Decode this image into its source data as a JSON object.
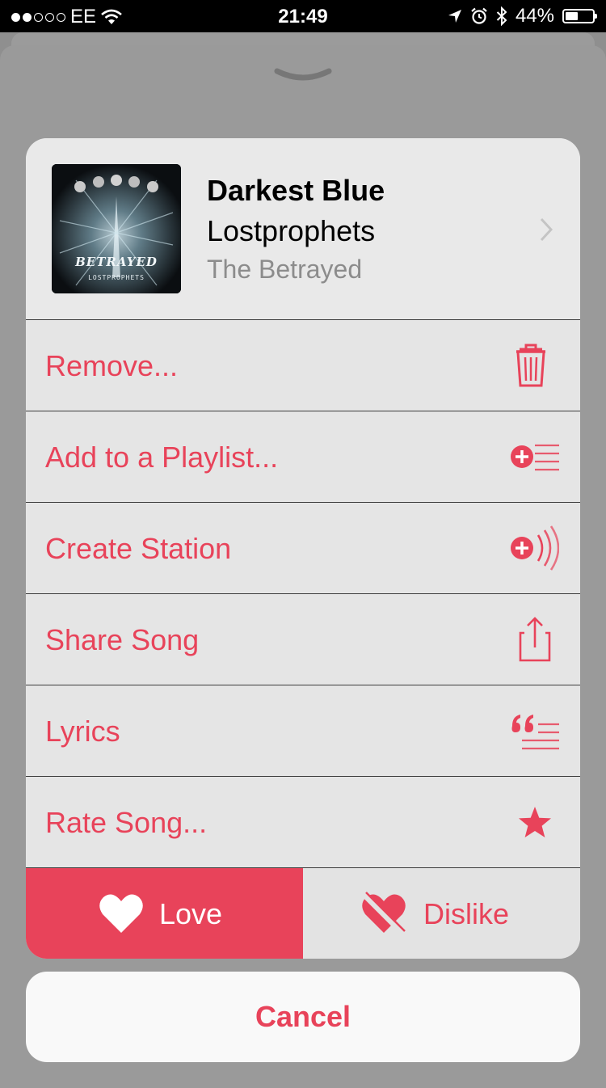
{
  "status_bar": {
    "carrier": "EE",
    "time": "21:49",
    "battery_percent": "44%",
    "battery_level": 0.44,
    "signal_bars_filled": 2,
    "signal_bars_total": 5
  },
  "song": {
    "title": "Darkest Blue",
    "artist": "Lostprophets",
    "album": "The Betrayed",
    "artwork_text": "BETRAYED",
    "artwork_subtext": "LOSTPROPHETS"
  },
  "actions": [
    {
      "label": "Remove...",
      "icon": "trash-icon"
    },
    {
      "label": "Add to a Playlist...",
      "icon": "add-to-playlist-icon"
    },
    {
      "label": "Create Station",
      "icon": "create-station-icon"
    },
    {
      "label": "Share Song",
      "icon": "share-icon"
    },
    {
      "label": "Lyrics",
      "icon": "lyrics-icon"
    },
    {
      "label": "Rate Song...",
      "icon": "star-icon"
    }
  ],
  "love": {
    "label": "Love",
    "icon": "heart-icon"
  },
  "dislike": {
    "label": "Dislike",
    "icon": "broken-heart-icon"
  },
  "cancel": {
    "label": "Cancel"
  },
  "colors": {
    "accent": "#e8435a",
    "card_background": "#e6e6e6",
    "dimmed_background": "#8f8f8f"
  }
}
